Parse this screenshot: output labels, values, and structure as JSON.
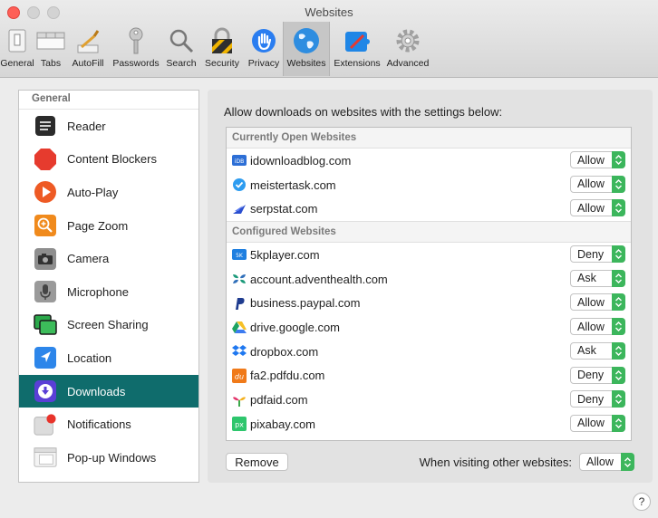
{
  "window": {
    "title": "Websites"
  },
  "toolbar": {
    "items": [
      {
        "label": "General",
        "icon": "general-icon"
      },
      {
        "label": "Tabs",
        "icon": "tabs-icon"
      },
      {
        "label": "AutoFill",
        "icon": "autofill-icon"
      },
      {
        "label": "Passwords",
        "icon": "key-icon"
      },
      {
        "label": "Search",
        "icon": "search-icon"
      },
      {
        "label": "Security",
        "icon": "lock-icon"
      },
      {
        "label": "Privacy",
        "icon": "hand-icon"
      },
      {
        "label": "Websites",
        "icon": "globe-icon",
        "active": true
      },
      {
        "label": "Extensions",
        "icon": "puzzle-icon"
      },
      {
        "label": "Advanced",
        "icon": "gear-icon"
      }
    ]
  },
  "sidebar": {
    "header": "General",
    "items": [
      {
        "label": "Reader",
        "icon": "reader-icon"
      },
      {
        "label": "Content Blockers",
        "icon": "stop-icon"
      },
      {
        "label": "Auto-Play",
        "icon": "play-icon"
      },
      {
        "label": "Page Zoom",
        "icon": "zoom-icon"
      },
      {
        "label": "Camera",
        "icon": "camera-icon"
      },
      {
        "label": "Microphone",
        "icon": "microphone-icon"
      },
      {
        "label": "Screen Sharing",
        "icon": "screen-sharing-icon"
      },
      {
        "label": "Location",
        "icon": "location-icon"
      },
      {
        "label": "Downloads",
        "icon": "download-icon",
        "selected": true
      },
      {
        "label": "Notifications",
        "icon": "notification-icon"
      },
      {
        "label": "Pop-up Windows",
        "icon": "popup-window-icon"
      }
    ]
  },
  "main": {
    "intro": "Allow downloads on websites with the settings below:",
    "current_header": "Currently Open Websites",
    "current_sites": [
      {
        "name": "idownloadblog.com",
        "value": "Allow"
      },
      {
        "name": "meistertask.com",
        "value": "Allow"
      },
      {
        "name": "serpstat.com",
        "value": "Allow"
      }
    ],
    "configured_header": "Configured Websites",
    "configured_sites": [
      {
        "name": "5kplayer.com",
        "value": "Deny"
      },
      {
        "name": "account.adventhealth.com",
        "value": "Ask"
      },
      {
        "name": "business.paypal.com",
        "value": "Allow"
      },
      {
        "name": "drive.google.com",
        "value": "Allow"
      },
      {
        "name": "dropbox.com",
        "value": "Ask"
      },
      {
        "name": "fa2.pdfdu.com",
        "value": "Deny"
      },
      {
        "name": "pdfaid.com",
        "value": "Deny"
      },
      {
        "name": "pixabay.com",
        "value": "Allow"
      }
    ],
    "remove_label": "Remove",
    "other_label": "When visiting other websites:",
    "other_value": "Allow",
    "help_label": "?"
  },
  "colors": {
    "accent": "#0f6c6c",
    "stepper": "#3cb65c"
  }
}
